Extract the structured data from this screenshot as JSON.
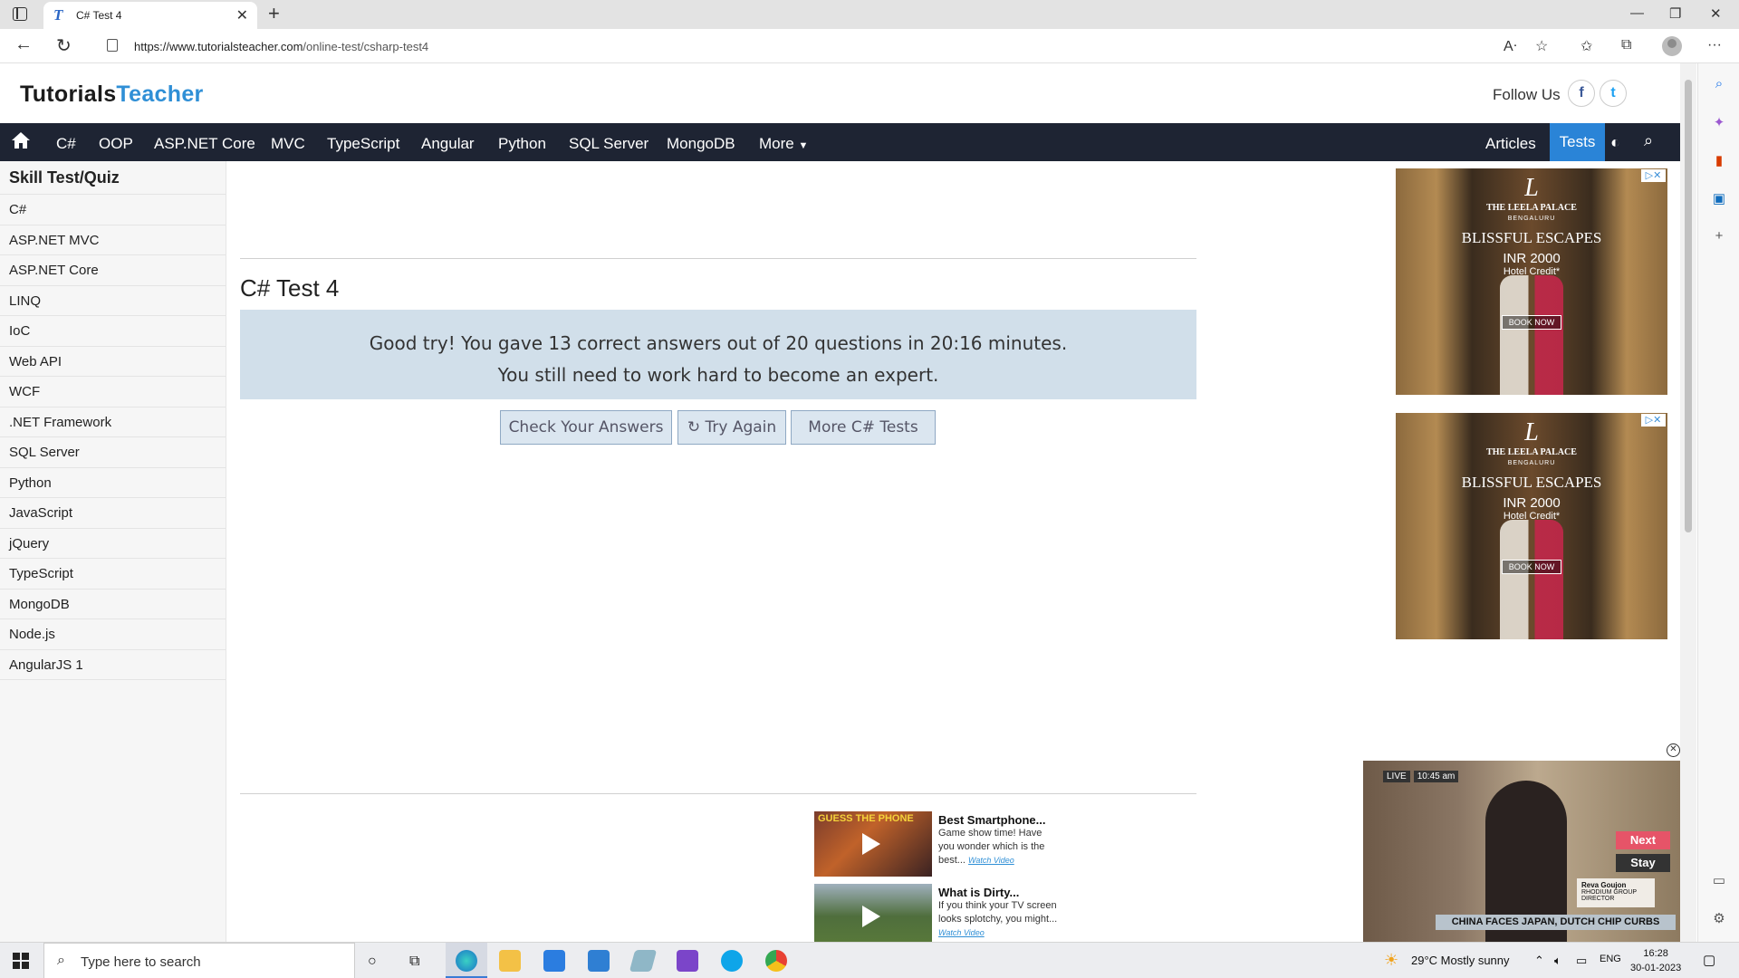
{
  "browser": {
    "tab_title": "C# Test 4",
    "tab_favicon": "T",
    "url_domain": "https://www.tutorialsteacher.com",
    "url_path": "/online-test/csharp-test4"
  },
  "site": {
    "logo_part1": "Tutorials",
    "logo_part2": "Teacher",
    "follow_label": "Follow Us",
    "facebook": "f",
    "twitter": "t"
  },
  "nav": {
    "items": [
      "C#",
      "OOP",
      "ASP.NET Core",
      "MVC",
      "TypeScript",
      "Angular",
      "Python",
      "SQL Server",
      "MongoDB",
      "More"
    ],
    "articles": "Articles",
    "tests": "Tests"
  },
  "sidebar": {
    "title": "Skill Test/Quiz",
    "items": [
      "C#",
      "ASP.NET MVC",
      "ASP.NET Core",
      "LINQ",
      "IoC",
      "Web API",
      "WCF",
      ".NET Framework",
      "SQL Server",
      "Python",
      "JavaScript",
      "jQuery",
      "TypeScript",
      "MongoDB",
      "Node.js",
      "AngularJS 1"
    ]
  },
  "main": {
    "title": "C# Test 4",
    "result_line1": "Good try! You gave 13 correct answers out of 20 questions in 20:16 minutes.",
    "result_line2": "You still need to work hard to become an expert.",
    "btn_check": "Check Your Answers",
    "btn_try_again": "Try Again",
    "btn_more": "More C# Tests"
  },
  "ad": {
    "logo": "L",
    "brand": "THE LEELA PALACE",
    "city": "BENGALURU",
    "headline": "BLISSFUL ESCAPES",
    "price": "INR 2000",
    "credit": "Hotel Credit*",
    "cta": "BOOK NOW"
  },
  "recommendations": [
    {
      "thumb_text": "GUESS THE PHONE",
      "title": "Best Smartphone...",
      "desc": "Game show time! Have you wonder which is the best...",
      "watch": "Watch Video"
    },
    {
      "thumb_text": "",
      "title": "What is Dirty...",
      "desc": "If you think your TV screen looks splotchy, you might...",
      "watch": "Watch Video"
    }
  ],
  "video": {
    "live": "LIVE",
    "time": "10:45 am",
    "next": "Next",
    "stay": "Stay",
    "person_name": "Reva Goujon",
    "person_role": "RHODIUM GROUP DIRECTOR",
    "ticker": "CHINA FACES JAPAN, DUTCH CHIP CURBS"
  },
  "taskbar": {
    "search_placeholder": "Type here to search",
    "weather": "29°C  Mostly sunny",
    "lang": "ENG",
    "time": "16:28",
    "date": "30-01-2023"
  }
}
